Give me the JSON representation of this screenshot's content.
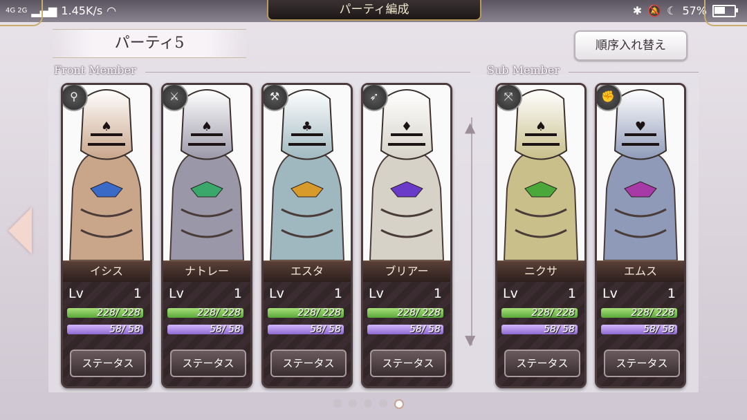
{
  "statusbar": {
    "network": "4G 2G",
    "speed": "1.45K/s",
    "battery": "57%",
    "battery_level": 0.57
  },
  "title_tab": "パーティ編成",
  "party_title": "パーティ5",
  "sort_button": "順序入れ替え",
  "sections": {
    "front": "Front Member",
    "sub": "Sub Member"
  },
  "members": [
    {
      "name": "イシス",
      "lv_label": "Lv",
      "lv": "1",
      "hp": "228/ 228",
      "mp": "58/ 58",
      "status": "ステータス",
      "icon": "staff-icon",
      "tint": "#c9a58a",
      "gem": "#3a6ac8",
      "suit": "♠"
    },
    {
      "name": "ナトレー",
      "lv_label": "Lv",
      "lv": "1",
      "hp": "228/ 228",
      "mp": "58/ 58",
      "status": "ステータス",
      "icon": "sword-icon",
      "tint": "#9a98a8",
      "gem": "#3aa86a",
      "suit": "♠"
    },
    {
      "name": "エスタ",
      "lv_label": "Lv",
      "lv": "1",
      "hp": "228/ 228",
      "mp": "58/ 58",
      "status": "ステータス",
      "icon": "axe-icon",
      "tint": "#9fb8c0",
      "gem": "#d89a2a",
      "suit": "♣"
    },
    {
      "name": "ブリアー",
      "lv_label": "Lv",
      "lv": "1",
      "hp": "228/ 228",
      "mp": "58/ 58",
      "status": "ステータス",
      "icon": "bow-icon",
      "tint": "#d6d2c8",
      "gem": "#6a3ac8",
      "suit": "♦"
    },
    {
      "name": "ニクサ",
      "lv_label": "Lv",
      "lv": "1",
      "hp": "228/ 228",
      "mp": "58/ 58",
      "status": "ステータス",
      "icon": "crossbow-icon",
      "tint": "#c9bf8a",
      "gem": "#4aa83a",
      "suit": "♠"
    },
    {
      "name": "エムス",
      "lv_label": "Lv",
      "lv": "1",
      "hp": "228/ 228",
      "mp": "58/ 58",
      "status": "ステータス",
      "icon": "fist-icon",
      "tint": "#8e9ab8",
      "gem": "#a83aa8",
      "suit": "♥"
    }
  ],
  "pagination": {
    "count": 5,
    "active": 5
  }
}
